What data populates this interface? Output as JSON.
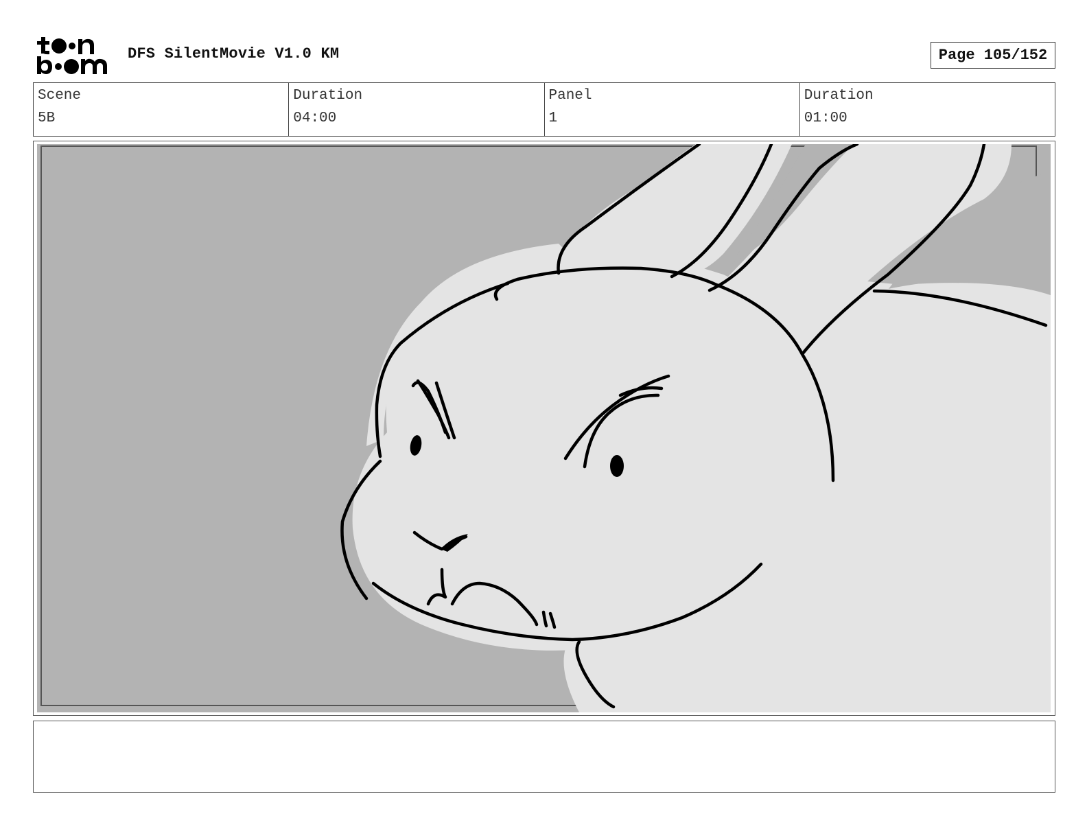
{
  "header": {
    "logo_text": "toon boom",
    "title": "DFS SilentMovie V1.0 KM",
    "page_label": "Page 105/152"
  },
  "info": {
    "scene_label": "Scene",
    "scene_value": "5B",
    "scene_duration_label": "Duration",
    "scene_duration_value": "04:00",
    "panel_label": "Panel",
    "panel_value": "1",
    "panel_duration_label": "Duration",
    "panel_duration_value": "01:00"
  },
  "panel": {
    "image_icon": "angry-rabbit-closeup-sketch",
    "background_color": "#b3b3b3",
    "fill_color": "#e4e4e4",
    "line_color": "#000000"
  },
  "notes": {
    "text": ""
  }
}
